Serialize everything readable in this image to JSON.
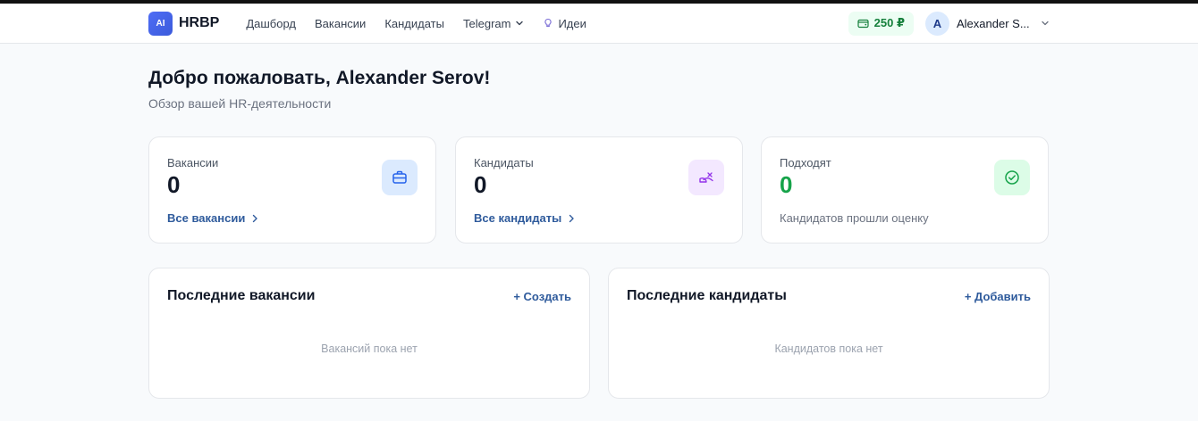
{
  "header": {
    "logo_badge": "AI",
    "logo_text": "HRBP",
    "nav": {
      "dashboard": "Дашборд",
      "vacancies": "Вакансии",
      "candidates": "Кандидаты",
      "telegram": "Telegram",
      "ideas": "Идеи"
    },
    "balance": "250 ₽",
    "user_initial": "A",
    "user_name": "Alexander S..."
  },
  "page": {
    "title": "Добро пожаловать, Alexander Serov!",
    "subtitle": "Обзор вашей HR-деятельности"
  },
  "stats": {
    "vacancies": {
      "label": "Вакансии",
      "value": "0",
      "link": "Все вакансии",
      "icon": "briefcase-icon"
    },
    "candidates": {
      "label": "Кандидаты",
      "value": "0",
      "link": "Все кандидаты",
      "icon": "hand-candidate-icon"
    },
    "matching": {
      "label": "Подходят",
      "value": "0",
      "note": "Кандидатов прошли оценку",
      "icon": "check-circle-icon"
    }
  },
  "panels": {
    "recent_vacancies": {
      "title": "Последние вакансии",
      "action": "+ Создать",
      "empty": "Вакансий пока нет"
    },
    "recent_candidates": {
      "title": "Последние кандидаты",
      "action": "+ Добавить",
      "empty": "Кандидатов пока нет"
    }
  },
  "colors": {
    "brand": "#3b5bdb",
    "link": "#2f5b9c",
    "success": "#16a34a",
    "balance_bg": "#ecfdf3"
  }
}
